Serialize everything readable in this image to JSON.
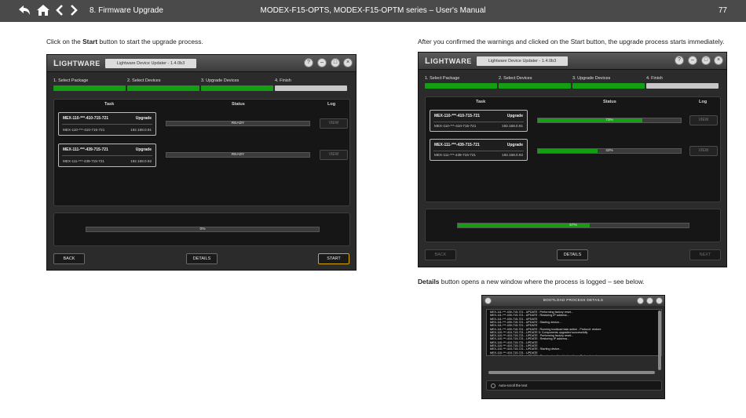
{
  "header": {
    "section": "8. Firmware Upgrade",
    "document_title": "MODEX-F15-OPTS, MODEX-F15-OPTM series – User's Manual",
    "page_number": "77",
    "icons": [
      "back-arrow-icon",
      "home-icon",
      "previous-page-icon",
      "next-page-icon"
    ]
  },
  "left": {
    "intro_pre": "Click on the ",
    "intro_bold": "Start",
    "intro_post": " button to start the upgrade process."
  },
  "right": {
    "intro": "After you confirmed the warnings and clicked on the Start button, the upgrade process starts immediately.",
    "details_bold": "Details",
    "details_post": " button opens a new window where the process is logged – see below."
  },
  "app_common": {
    "logo_first": "L",
    "logo_rest": "IGHTWARE",
    "app_name": "Lightware Device Updater - 1.4.0b3",
    "steps": [
      "1. Select Package",
      "2. Select Devices",
      "3. Upgrade Devices",
      "4. Finish"
    ],
    "col_task": "Task",
    "col_status": "Status",
    "col_log": "Log",
    "view_label": "VIEW",
    "back_label": "BACK",
    "details_label": "DETAILS",
    "start_label": "START",
    "next_label": "NEXT",
    "upgrade_label": "Upgrade"
  },
  "app_left": {
    "devices": [
      {
        "name": "MEX-110-***-410-715-721",
        "sub": "MEX-110-***-410-715-721",
        "ip": "192.168.0.91",
        "status": "READY",
        "progress": 0
      },
      {
        "name": "MEX-111-***-439-715-721",
        "sub": "MEX-111-***-439-715-721",
        "ip": "192.168.0.92",
        "status": "READY",
        "progress": 0
      }
    ],
    "overall_text": "0%",
    "overall_progress": 0
  },
  "app_right": {
    "devices": [
      {
        "name": "MEX-110-***-410-715-721",
        "sub": "MEX-110-***-410-715-721",
        "ip": "192.168.0.91",
        "status": "73%",
        "progress": 0.73
      },
      {
        "name": "MEX-111-***-439-715-721",
        "sub": "MEX-111-***-439-715-721",
        "ip": "192.168.0.92",
        "status": "42%",
        "progress": 0.42
      }
    ],
    "overall_text": "57%",
    "overall_progress": 0.57
  },
  "bootload": {
    "title": "BOOTLOAD PROCESS DETAILS",
    "log_lines": [
      "MEX-111-***-439-715-721 - UPDATE : Performing factory reset...",
      "MEX-111-***-439-715-721 - UPDATE : Restoring IP address...",
      "MEX-111-***-439-715-721 - UPDATE",
      "MEX-111-***-439-715-721 - UPDATE : Starting device...",
      "MEX-111-***-439-715-721 - UPDATE",
      "MEX-111-***-439-715-721 - UPDATE : Running bootload task action - Protocol: restore",
      "MEX-110-***-410-715-721 - UPDATE 0: Components upgraded successfully",
      "MEX-110-***-410-715-721 - UPDATE : Performing factory reset...",
      "MEX-110-***-410-715-721 - UPDATE : Restoring IP address...",
      "MEX-110-***-410-715-721 - UPDATE",
      "MEX-110-***-410-715-721 - UPDATE",
      "MEX-110-***-410-715-721 - UPDATE : Starting device...",
      "MEX-110-***-410-715-721 - UPDATE",
      "MEX-110-***-410-715-721 - UPDATE : Running bootload task action - Protocol: restore"
    ],
    "autoscroll_label": "Auto-scroll the text"
  },
  "colors": {
    "topbar": "#4a4a4a",
    "step_done": "#12a012",
    "step_todo": "#c8c8c8",
    "progress_fill": "#12a012",
    "start_border": "#d8a800"
  }
}
